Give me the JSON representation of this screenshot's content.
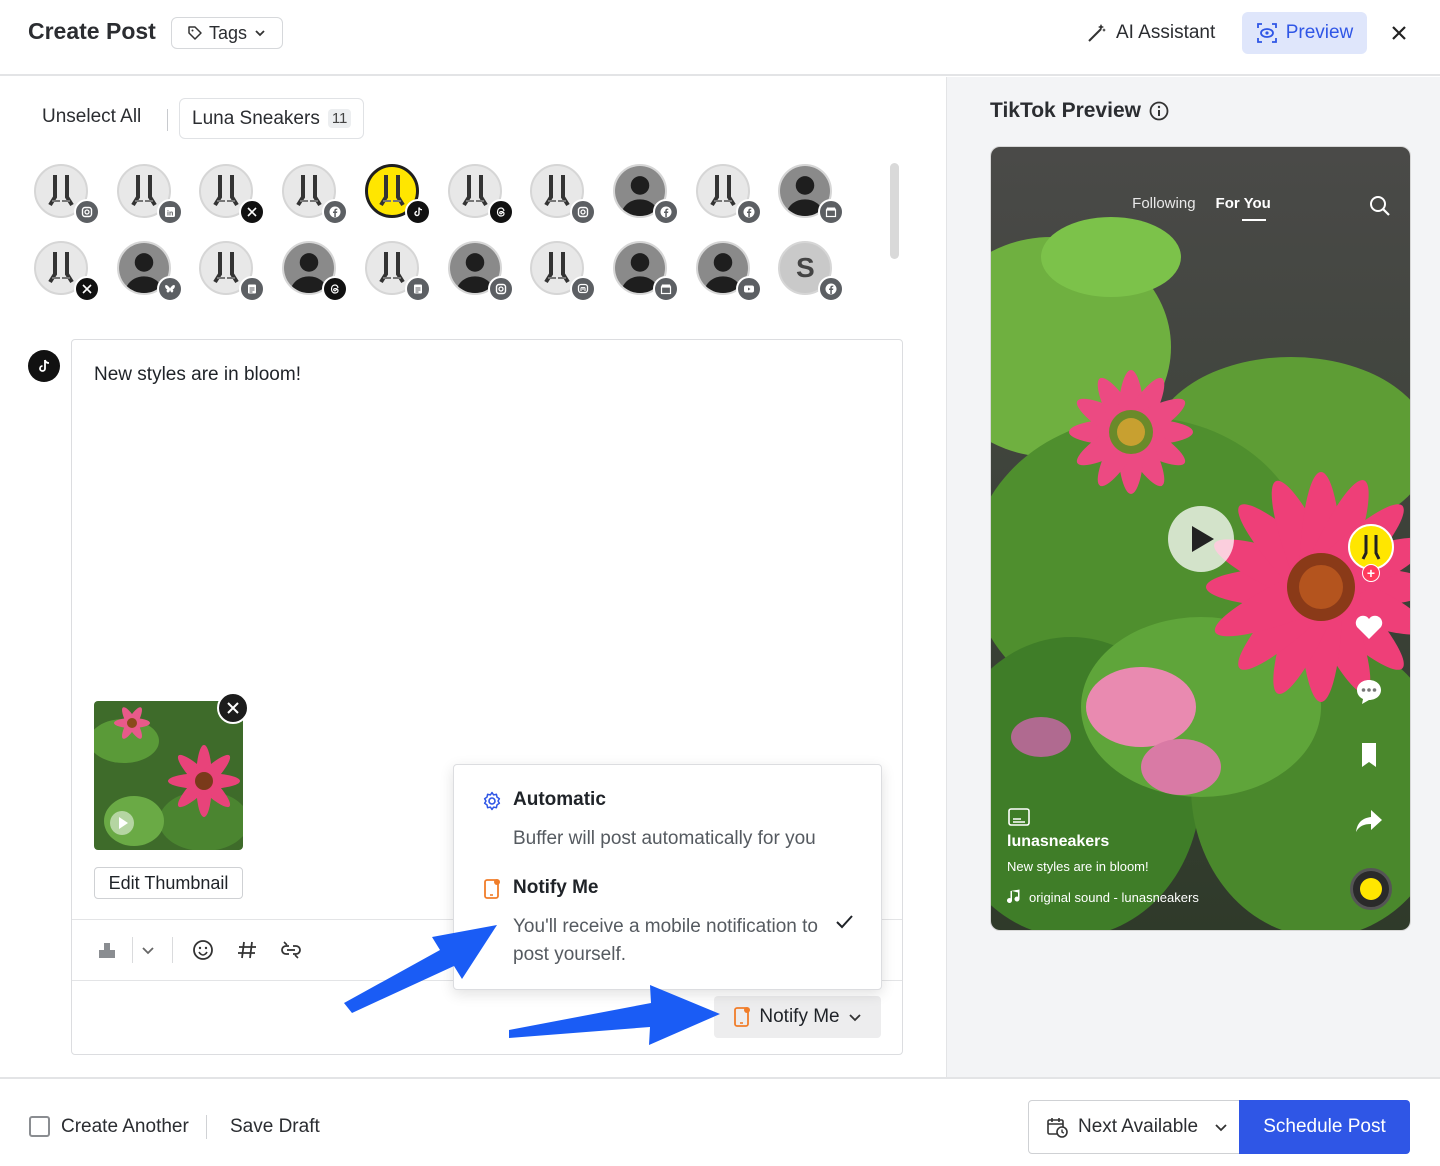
{
  "header": {
    "title": "Create Post",
    "tags_label": "Tags",
    "ai_assistant_label": "AI Assistant",
    "preview_label": "Preview"
  },
  "channels": {
    "unselect_all": "Unselect All",
    "group_name": "Luna Sneakers",
    "group_count": "11",
    "avatars": [
      {
        "badge": "instagram",
        "selected": false
      },
      {
        "badge": "linkedin",
        "selected": false
      },
      {
        "badge": "x",
        "selected": false
      },
      {
        "badge": "facebook",
        "selected": false
      },
      {
        "badge": "tiktok",
        "selected": true
      },
      {
        "badge": "threads",
        "selected": false
      },
      {
        "badge": "instagram",
        "selected": false
      },
      {
        "badge": "facebook",
        "selected": false
      },
      {
        "badge": "facebook",
        "selected": false
      },
      {
        "badge": "google-business",
        "selected": false
      },
      {
        "badge": "x",
        "selected": false
      },
      {
        "badge": "bluesky",
        "selected": false
      },
      {
        "badge": "startpage",
        "selected": false
      },
      {
        "badge": "threads",
        "selected": false
      },
      {
        "badge": "startpage",
        "selected": false
      },
      {
        "badge": "instagram",
        "selected": false
      },
      {
        "badge": "mastodon",
        "selected": false
      },
      {
        "badge": "google-business",
        "selected": false
      },
      {
        "badge": "youtube",
        "selected": false
      },
      {
        "badge": "facebook",
        "selected": false,
        "letter": "S"
      }
    ]
  },
  "composer": {
    "text": "New styles are in bloom!",
    "edit_thumbnail": "Edit Thumbnail",
    "publish_mode": "Notify Me"
  },
  "dropdown": {
    "options": [
      {
        "title": "Automatic",
        "description": "Buffer will post automatically for you"
      },
      {
        "title": "Notify Me",
        "description_line1": "You'll receive a mobile notification to",
        "description_line2": "post yourself.",
        "checked": true
      }
    ]
  },
  "preview": {
    "title": "TikTok Preview",
    "tab_following": "Following",
    "tab_foryou": "For You",
    "username": "lunasneakers",
    "caption": "New styles are in bloom!",
    "sound": "original sound - lunasneakers"
  },
  "footer": {
    "create_another": "Create Another",
    "save_draft": "Save Draft",
    "next_available": "Next Available",
    "schedule_post": "Schedule Post"
  },
  "colors": {
    "accent": "#2f56e6",
    "notify_orange": "#f07d2a",
    "arrow_blue": "#1a5cf5"
  }
}
